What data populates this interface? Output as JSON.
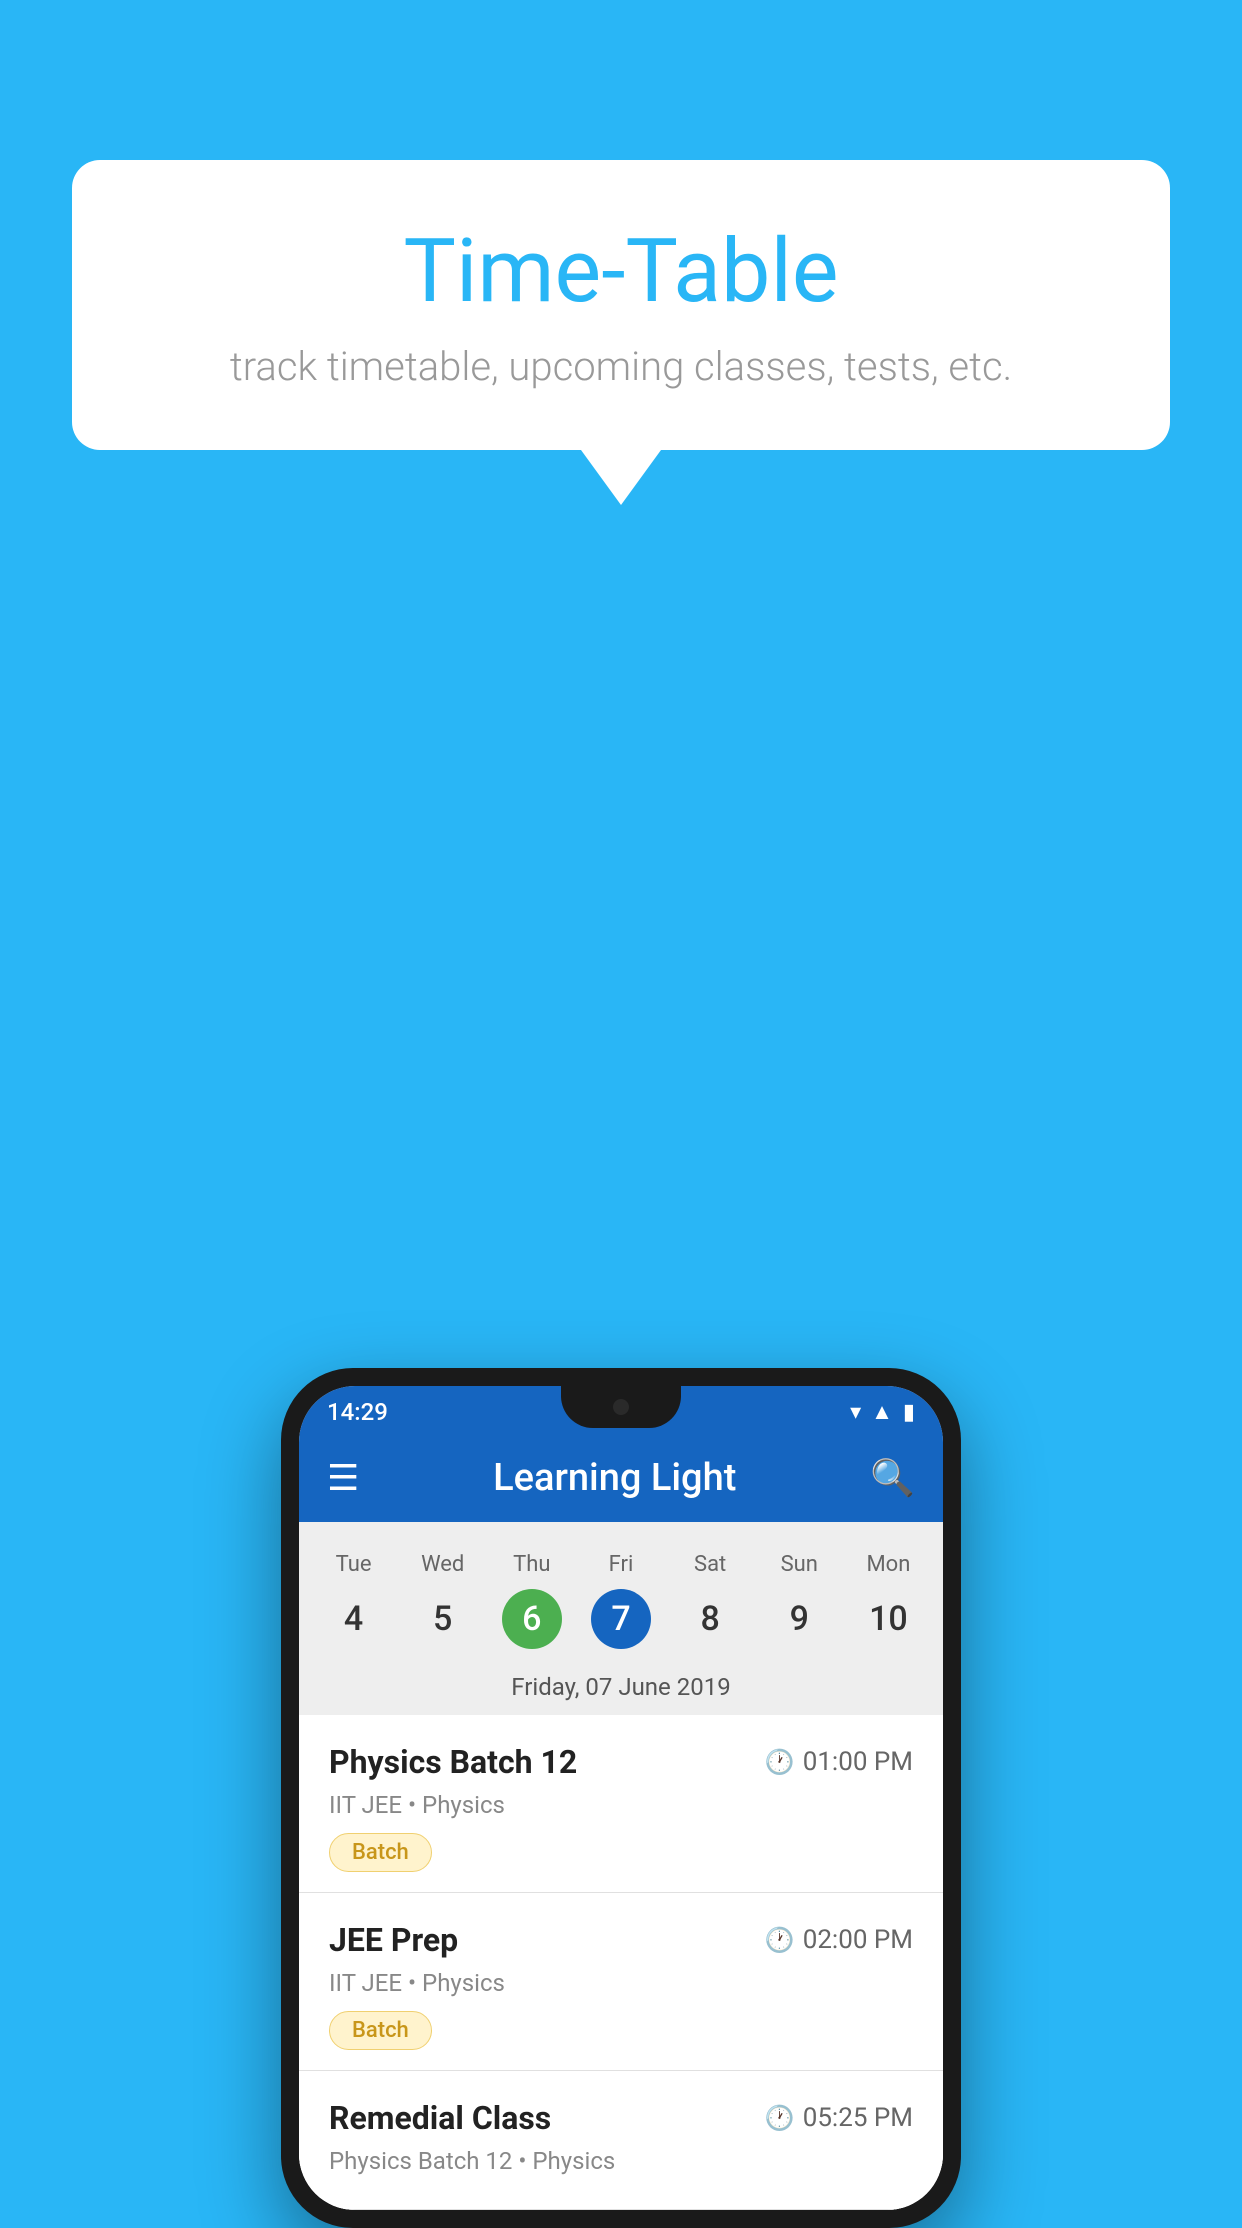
{
  "background_color": "#29B6F6",
  "speech_bubble": {
    "title": "Time-Table",
    "subtitle": "track timetable, upcoming classes, tests, etc."
  },
  "phone": {
    "status_bar": {
      "time": "14:29"
    },
    "app_bar": {
      "title": "Learning Light",
      "menu_icon": "☰",
      "search_icon": "🔍"
    },
    "calendar": {
      "days": [
        {
          "name": "Tue",
          "number": "4",
          "state": "normal"
        },
        {
          "name": "Wed",
          "number": "5",
          "state": "normal"
        },
        {
          "name": "Thu",
          "number": "6",
          "state": "today"
        },
        {
          "name": "Fri",
          "number": "7",
          "state": "selected"
        },
        {
          "name": "Sat",
          "number": "8",
          "state": "normal"
        },
        {
          "name": "Sun",
          "number": "9",
          "state": "normal"
        },
        {
          "name": "Mon",
          "number": "10",
          "state": "normal"
        }
      ],
      "selected_date_label": "Friday, 07 June 2019"
    },
    "classes": [
      {
        "name": "Physics Batch 12",
        "time": "01:00 PM",
        "meta": "IIT JEE • Physics",
        "tag": "Batch"
      },
      {
        "name": "JEE Prep",
        "time": "02:00 PM",
        "meta": "IIT JEE • Physics",
        "tag": "Batch"
      },
      {
        "name": "Remedial Class",
        "time": "05:25 PM",
        "meta": "Physics Batch 12 • Physics",
        "tag": ""
      }
    ]
  }
}
